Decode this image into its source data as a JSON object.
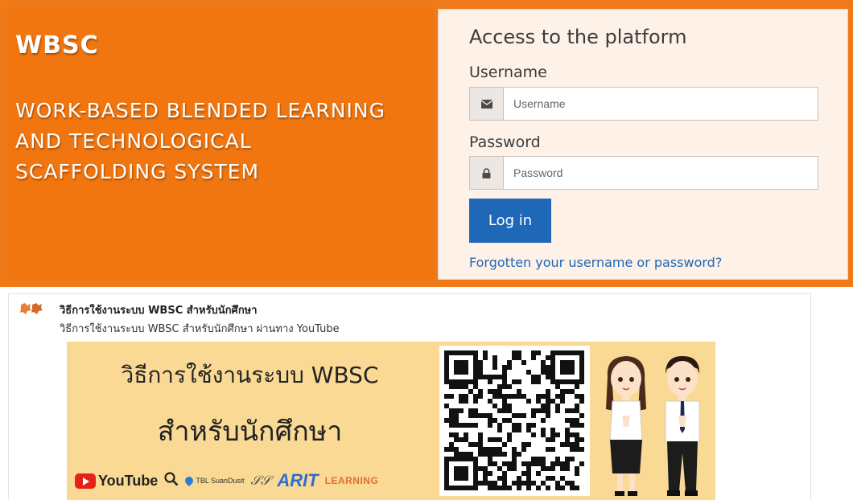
{
  "hero": {
    "brand": "WBSC",
    "tagline_lines": [
      "WORK-BASED BLENDED LEARNING",
      "AND TECHNOLOGICAL",
      "SCAFFOLDING SYSTEM"
    ]
  },
  "login": {
    "title": "Access to the platform",
    "username_label": "Username",
    "username_placeholder": "Username",
    "username_icon": "envelope-icon",
    "password_label": "Password",
    "password_placeholder": "Password",
    "password_icon": "lock-icon",
    "login_button": "Log in",
    "forgot_link": "Forgotten your username or password?"
  },
  "card": {
    "title": "วิธีการใช้งานระบบ WBSC สำหรับนักศึกษา",
    "description": "วิธีการใช้งานระบบ WBSC สำหรับนักศึกษา ผ่านทาง YouTube",
    "banner": {
      "line1": "วิธีการใช้งานระบบ  WBSC",
      "line2": "สำหรับนักศึกษา",
      "logos": {
        "youtube": "YouTube",
        "tbl": "TBL SuanDusit",
        "arit": "ARIT",
        "learning": "LEARNING"
      }
    }
  },
  "colors": {
    "orange": "#f07a1a",
    "panel": "#fdf1e8",
    "primary": "#1f68b8",
    "banner": "#f9d994"
  }
}
